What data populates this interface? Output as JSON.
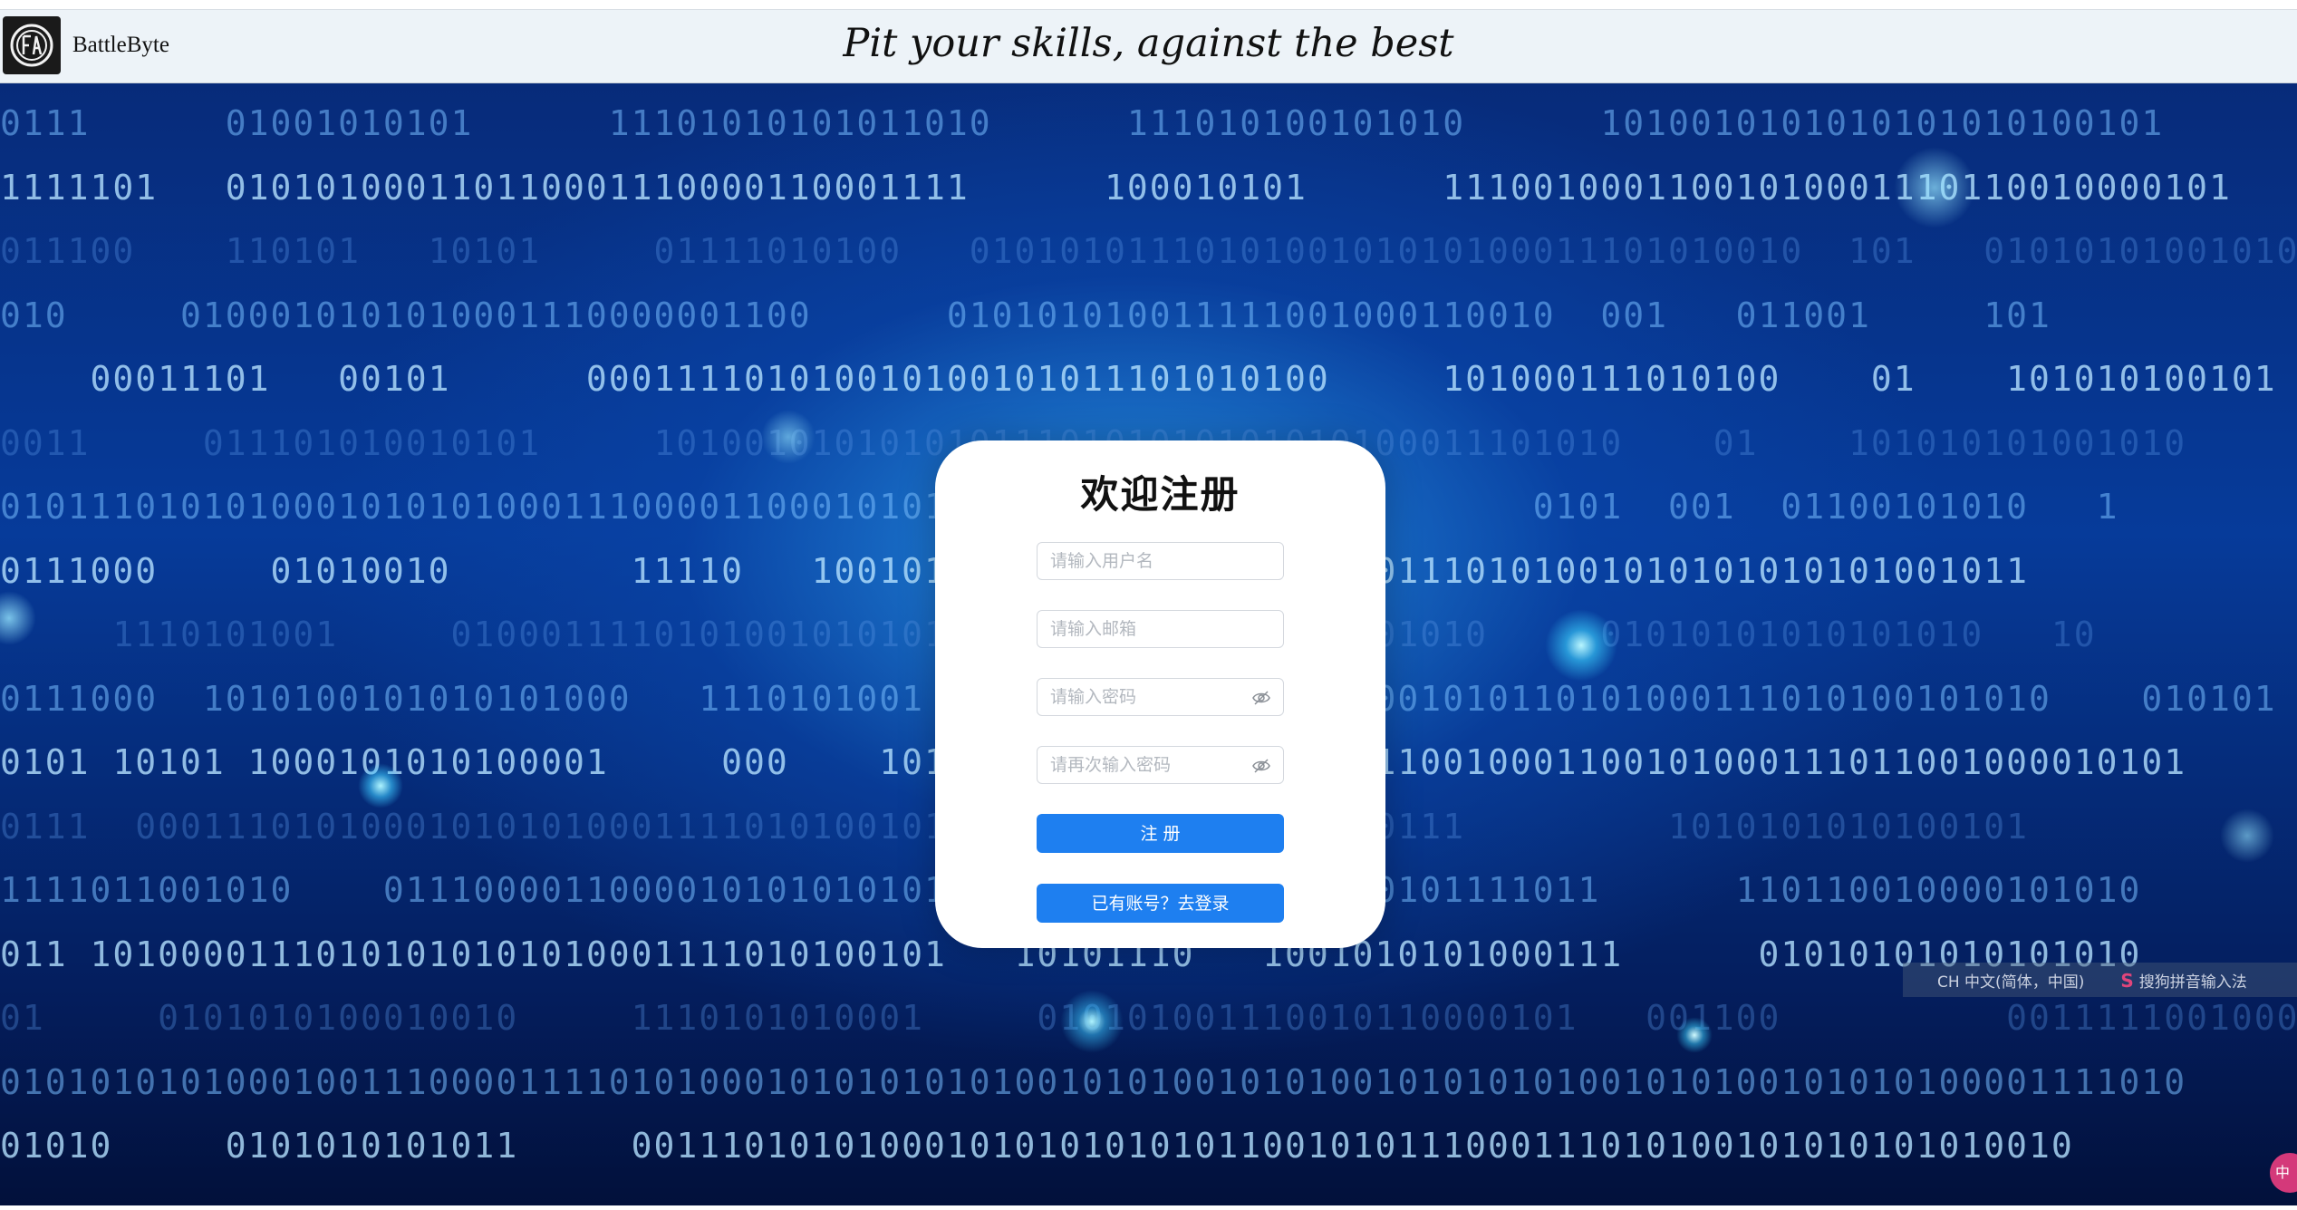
{
  "header": {
    "brand": "BattleByte",
    "tagline": "Pit your skills, against the best",
    "logo_icon": "bb-emblem-icon"
  },
  "background": {
    "binary_rows": [
      "0111      01001010101      11101010101011010      111010100101010      1010010101010101010100101",
      "1111101   010101000110110001110000110001111      100010101      11100100011001010001110110010000101",
      "011100    110101   10101     01111010100   0101010111010100101010100011101010010  101   010101010010101",
      "010     0100010101010001110000001100      010101010011111001000110010  001   011001     101",
      "    00011101   00101      000111101010010100101011101010100     101000111010100    01    101010100101",
      "0011     011101010010101     1010010101010101110101010101010100011101010    01    101010101001010",
      "0101110101010001010101000111000011000101010101011111111110010       0101  001  01100101010   1",
      "0111000     01010010        11110   100101010101010100101010001110101001010101010101001011",
      "     1110101001     0100011110101001010101010100001010101010101010     01010101010101010   10",
      "0111000  1010100101010101000   1110101001  001010100101010101001010110101000111010100101010    010101",
      "0101 10101 1000101010100001     000    1010101000011101000111110010001100101000111011001000010101",
      "0111  00011101010001010101000111101010010110101010101010101000111         1010101010100101",
      "1111011001010    011100001100001010101010101011111001000110010101111011      110110010000101010",
      "011 10100001110101010101010001111010100101   10101110   1001010101000111      01010101010101010",
      "01     0101010100010010     1110101010001     010101001110010110000101   001100          001111100100011100",
      "0101010101000100111000011110101000101010101010010101001010100101010101001010100101010100001111010",
      "01010     0101010101011     0011101010100010101010101011001010111000111010100101010101010010"
    ]
  },
  "ime": {
    "label": "CH 中文(简体，中国)",
    "app": "搜狗拼音输入法",
    "badge": "中"
  },
  "form": {
    "title": "欢迎注册",
    "username_placeholder": "请输入用户名",
    "email_placeholder": "请输入邮箱",
    "password_placeholder": "请输入密码",
    "confirm_placeholder": "请再次输入密码",
    "register_label": "注 册",
    "login_label": "已有账号？去登录",
    "password_toggle_icon": "eye-off-icon"
  },
  "colors": {
    "primary_button": "#1e7ff0",
    "header_bg": "#edf3f8",
    "background_blue": "#063b9a"
  }
}
